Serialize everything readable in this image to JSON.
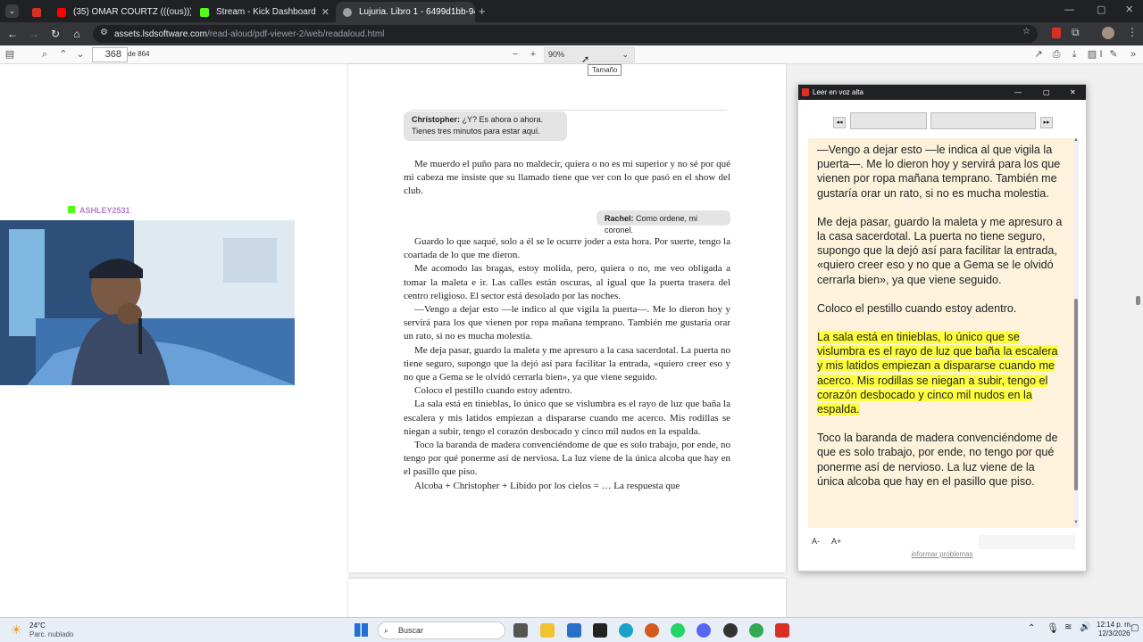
{
  "tabs": [
    {
      "label": "",
      "color": "#d93025"
    },
    {
      "label": "(35) OMAR COURTZ (((ous))), N",
      "color": "#ff0000"
    },
    {
      "label": "Stream - Kick Dashboard",
      "color": "#53fc18"
    },
    {
      "label": "Lujuria. Libro 1 - 6499d1bb-94",
      "color": "#9aa0a6"
    }
  ],
  "address": {
    "host": "assets.lsdsoftware.com",
    "path": "/read-aloud/pdf-viewer-2/web/readaloud.html"
  },
  "pdf_toolbar": {
    "page": "368",
    "of": "de 864",
    "zoom": "90%",
    "tooltip": "Tamaño"
  },
  "page": {
    "bubble1_name": "Christopher:",
    "bubble1_text": " ¿Y? Es ahora o ahora.",
    "bubble1_line2": "Tienes tres minutos para estar aquí.",
    "para1": "Me muerdo el puño para no maldecir, quiera o no es mi superior y no sé por qué mi cabeza me insiste que su llamado tiene que ver con lo que pasó en el show del club.",
    "bubble2_name": "Rachel:",
    "bubble2_text": " Como ordene, mi coronel.",
    "paras": [
      "Guardo lo que saqué, solo a él se le ocurre joder a esta hora. Por suerte, tengo la coartada de lo que me dieron.",
      "Me acomodo las bragas, estoy molida, pero, quiera o no, me veo obligada a tomar la maleta e ir. Las calles están oscuras, al igual que la puerta trasera del centro religioso. El sector está desolado por las noches.",
      "—Vengo a dejar esto —le indico al que vigila la puerta—. Me lo dieron hoy y servirá para los que vienen por ropa mañana temprano. También me gustaría orar un rato, si no es mucha molestia.",
      "Me deja pasar, guardo la maleta y me apresuro a la casa sacerdotal. La puerta no tiene seguro, supongo que la dejó así para facilitar la entrada, «quiero creer eso y no que a Gema se le olvidó cerrarla bien», ya que viene seguido.",
      "Coloco el pestillo cuando estoy adentro.",
      "La sala está en tinieblas, lo único que se vislumbra es el rayo de luz que baña la escalera y mis latidos empiezan a dispararse cuando me acerco. Mis rodillas se niegan a subir, tengo el corazón desbocado y cinco mil nudos en la espalda.",
      "Toco la baranda de madera convenciéndome de que es solo trabajo, por ende, no tengo por qué ponerme así de nerviosa. La luz viene de la única alcoba que hay en el pasillo que piso.",
      "Alcoba + Christopher + Libido por los cielos = … La respuesta que"
    ]
  },
  "stream": {
    "chat_user": "ASHLEY2531"
  },
  "readaloud": {
    "title": "Leer en voz alta",
    "prev": "◂◂",
    "next": "▸▸",
    "p1": "—Vengo a dejar esto —le indica al que vigila la puerta—. Me lo dieron hoy y servirá para los que vienen por ropa mañana temprano. También me gustaría orar un rato, si no es mucha molestia.",
    "p2": "Me deja pasar, guardo la maleta y me apresuro a la casa sacerdotal. La puerta no tiene seguro, supongo que la dejó así para facilitar la entrada, «quiero creer eso y no que a Gema se le olvidó cerrarla bien», ya que viene seguido.",
    "p3": "Coloco el pestillo cuando estoy adentro.",
    "p4": "La sala está en tinieblas, lo único que se vislumbra es el rayo de luz que baña la escalera y mis latidos empiezan a dispararse cuando me acerco. Mis rodillas se niegan a subir, tengo el corazón desbocado y cinco mil nudos en la espalda.",
    "p5": "Toco la baranda de madera convenciéndome de que es solo trabajo, por ende, no tengo por qué ponerme así de nervioso. La luz viene de la única alcoba que hay en el pasillo que piso.",
    "font_down": "A-",
    "font_up": "A+",
    "report": "informar problemas",
    "highlight_color": "#ffff3b"
  },
  "taskbar": {
    "temp": "24°C",
    "weather": "Parc. nublado",
    "search": "Buscar",
    "time": "12:14 p. m.",
    "date": "12/3/2026"
  }
}
